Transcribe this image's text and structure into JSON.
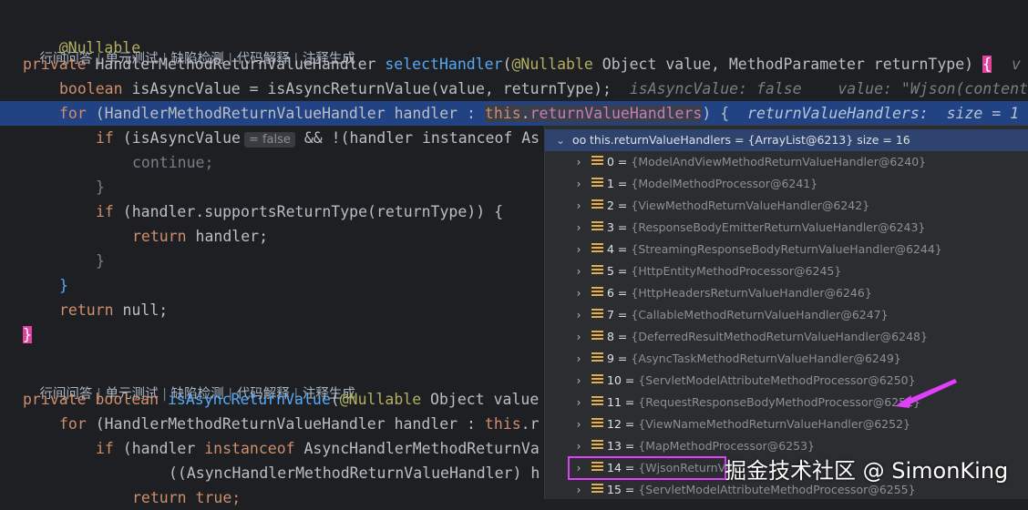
{
  "code": {
    "annotation": "@Nullable",
    "lens": {
      "items": [
        "行间问答",
        "单元测试",
        "缺陷检测",
        "代码解释",
        "注释生成"
      ],
      "separator": " | "
    },
    "method1": {
      "kw_private": "private",
      "return_type": "HandlerMethodReturnValueHandler",
      "name": "selectHandler",
      "params_open": "(",
      "param_ann": "@Nullable",
      "params_rest": " Object value, MethodParameter returnType) ",
      "brace_open": "{",
      "hint_right": "v",
      "l_boolean_kw": "boolean",
      "l_boolean_rest": " isAsyncValue = ",
      "l_boolean_call": "isAsyncReturnValue",
      "l_boolean_args": "(value, returnType);",
      "l_boolean_hint": "isAsyncValue: false    value: \"Wjson(content",
      "l_for_kw": "for",
      "l_for_mid": " (HandlerMethodReturnValueHandler handler : ",
      "l_for_this": "this",
      "l_for_dot": ".",
      "l_for_field": "returnValueHandlers",
      "l_for_end": ") {",
      "l_for_hint": "returnValueHandlers:  size = 1",
      "l_if_kw": "if",
      "l_if_a": " (isAsyncValue",
      "l_if_inlay": "= false",
      "l_if_b": " && !(handler instanceof As",
      "l_continue": "continue;",
      "l_close1": "}",
      "l_if2_kw": "if",
      "l_if2_rest": " (handler.supportsReturnType(returnType)) {",
      "l_return_kw": "return",
      "l_return_rest": " handler;",
      "l_close2": "}",
      "l_close3": "}",
      "l_return_null_kw": "return",
      "l_return_null_rest": " null;",
      "brace_close": "}"
    },
    "method2": {
      "kw_private": "private",
      "kw_boolean": "boolean",
      "name": "isAsyncReturnValue",
      "params_open": "(",
      "param_ann": "@Nullable",
      "params_rest": " Object value",
      "l_for_kw": "for",
      "l_for_rest": " (HandlerMethodReturnValueHandler handler : ",
      "l_for_this": "this",
      "l_for_tail": ".r",
      "l_if_kw": "if",
      "l_if_a": " (handler ",
      "l_if_instanceof": "instanceof",
      "l_if_b": " AsyncHandlerMethodReturnVa",
      "l_cast": "((AsyncHandlerMethodReturnValueHandler) h",
      "l_return_kw": "return",
      "l_return_true": " true;"
    }
  },
  "debugger": {
    "header": "this.returnValueHandlers = {ArrayList@6213}  size = 16",
    "header_icon": "watch-glasses-icon",
    "entries": [
      {
        "index": "0",
        "value": "{ModelAndViewMethodReturnValueHandler@6240}"
      },
      {
        "index": "1",
        "value": "{ModelMethodProcessor@6241}"
      },
      {
        "index": "2",
        "value": "{ViewMethodReturnValueHandler@6242}"
      },
      {
        "index": "3",
        "value": "{ResponseBodyEmitterReturnValueHandler@6243}"
      },
      {
        "index": "4",
        "value": "{StreamingResponseBodyReturnValueHandler@6244}"
      },
      {
        "index": "5",
        "value": "{HttpEntityMethodProcessor@6245}"
      },
      {
        "index": "6",
        "value": "{HttpHeadersReturnValueHandler@6246}"
      },
      {
        "index": "7",
        "value": "{CallableMethodReturnValueHandler@6247}"
      },
      {
        "index": "8",
        "value": "{DeferredResultMethodReturnValueHandler@6248}"
      },
      {
        "index": "9",
        "value": "{AsyncTaskMethodReturnValueHandler@6249}"
      },
      {
        "index": "10",
        "value": "{ServletModelAttributeMethodProcessor@6250}"
      },
      {
        "index": "11",
        "value": "{RequestResponseBodyMethodProcessor@6251}"
      },
      {
        "index": "12",
        "value": "{ViewNameMethodReturnValueHandler@6252}"
      },
      {
        "index": "13",
        "value": "{MapMethodProcessor@6253}"
      },
      {
        "index": "14",
        "value": "{WjsonReturnVal"
      },
      {
        "index": "15",
        "value": "{ServletModelAttributeMethodProcessor@6255}"
      }
    ],
    "eq": " = ",
    "highlighted_index": "14",
    "highlight_color": "#e040fb"
  },
  "watermark": "掘金技术社区 @ SimonKing"
}
